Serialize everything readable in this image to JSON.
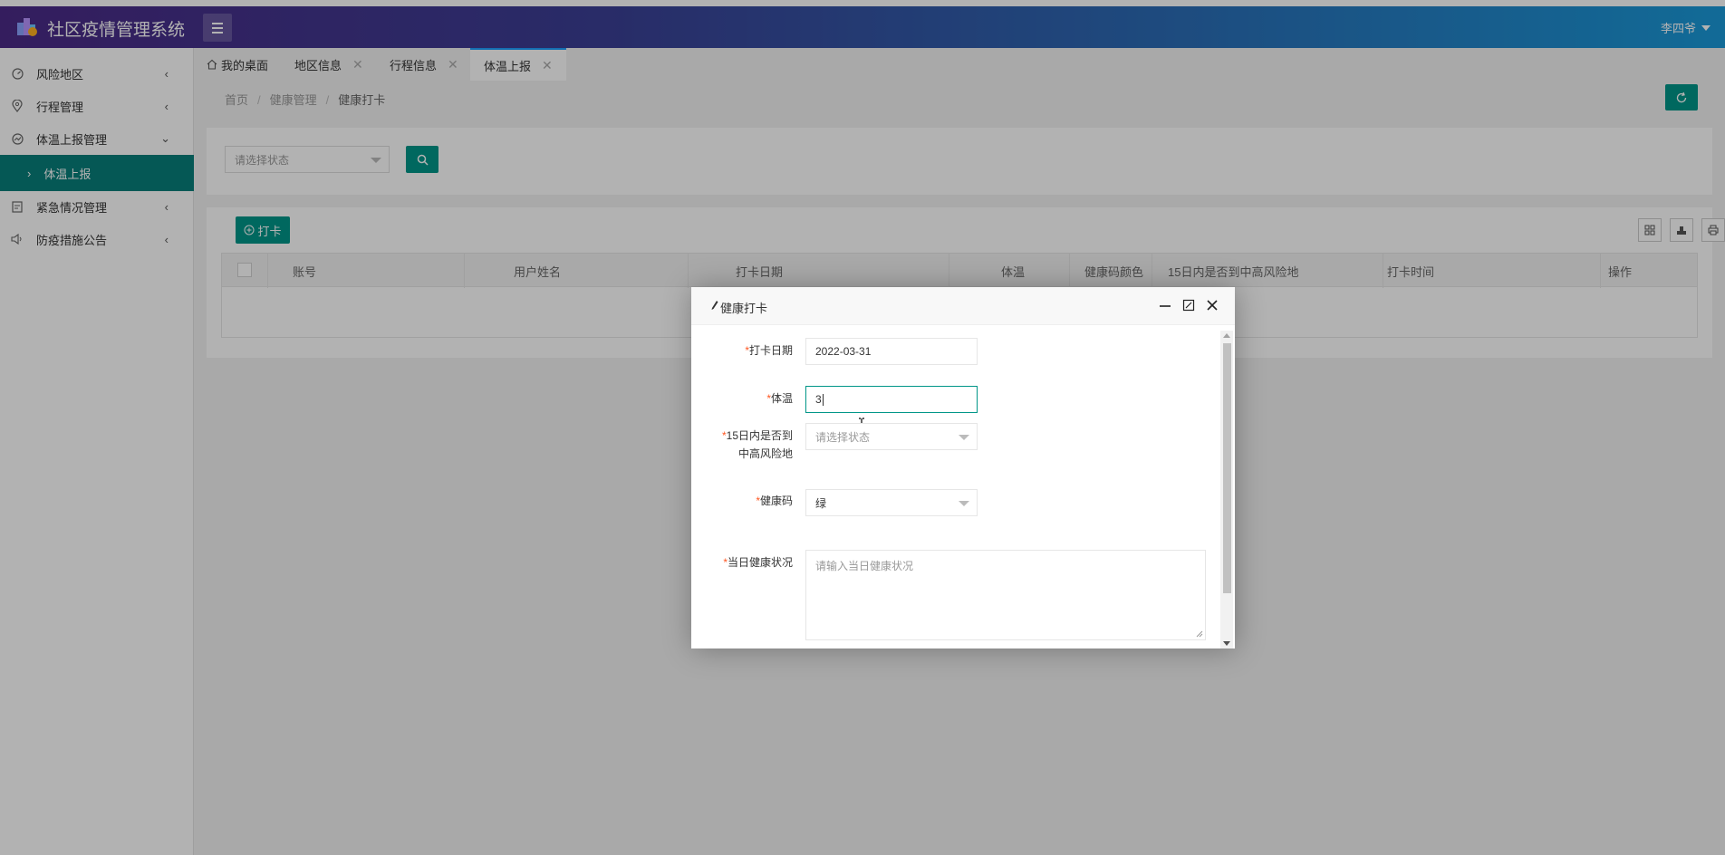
{
  "header": {
    "app_title": "社区疫情管理系统",
    "user_name": "李四爷"
  },
  "sidebar": {
    "items": [
      {
        "label": "风险地区",
        "icon": "gauge-icon"
      },
      {
        "label": "行程管理",
        "icon": "location-pin-icon"
      },
      {
        "label": "体温上报管理",
        "icon": "chart-icon"
      },
      {
        "label": "紧急情况管理",
        "icon": "clipboard-icon"
      },
      {
        "label": "防疫措施公告",
        "icon": "speaker-icon"
      }
    ],
    "active_sub": {
      "label": "体温上报"
    }
  },
  "tabs": [
    {
      "label": "我的桌面"
    },
    {
      "label": "地区信息"
    },
    {
      "label": "行程信息"
    },
    {
      "label": "体温上报"
    }
  ],
  "breadcrumb": {
    "home": "首页",
    "section": "健康管理",
    "current": "健康打卡"
  },
  "filter": {
    "status_placeholder": "请选择状态"
  },
  "toolbar": {
    "punch_label": "打卡"
  },
  "table": {
    "columns": [
      "账号",
      "用户姓名",
      "打卡日期",
      "体温",
      "健康码颜色",
      "15日内是否到中高风险地",
      "打卡时间",
      "操作"
    ]
  },
  "modal": {
    "title": "健康打卡",
    "fields": {
      "date": {
        "label": "打卡日期",
        "value": "2022-03-31"
      },
      "temp": {
        "label": "体温",
        "value": "3"
      },
      "risk": {
        "label_line1": "15日内是否到",
        "label_line2": "中高风险地",
        "placeholder": "请选择状态"
      },
      "code": {
        "label": "健康码",
        "value": "绿"
      },
      "status": {
        "label": "当日健康状况",
        "placeholder": "请输入当日健康状况"
      }
    }
  },
  "colors": {
    "accent": "#009688",
    "sidebar_active": "#087f7a",
    "required": "#ff5722"
  }
}
